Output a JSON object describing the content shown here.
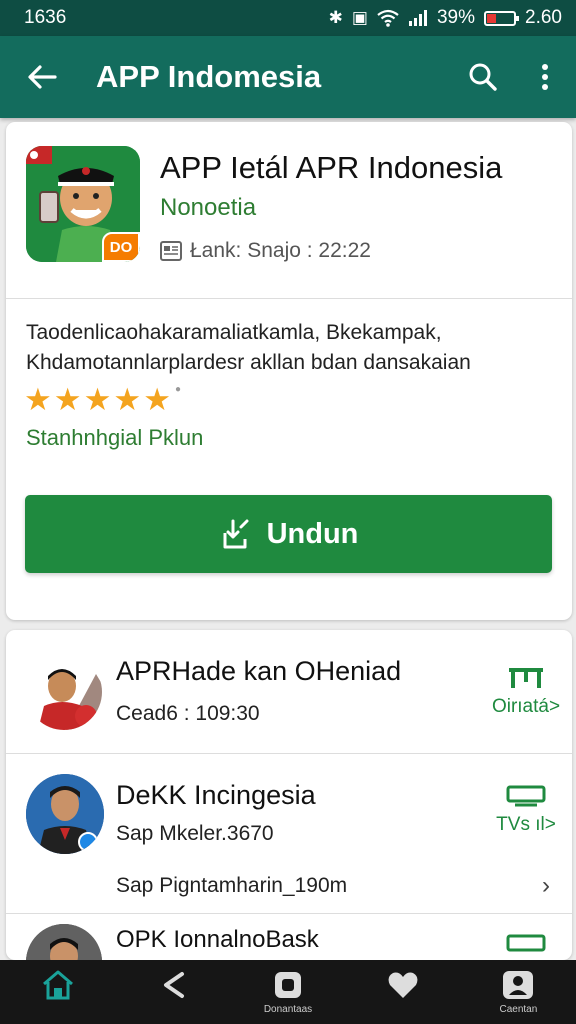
{
  "status_bar": {
    "time": "1636",
    "battery_text": "39%",
    "clock_right": "2.60"
  },
  "app_bar": {
    "title": "APP Indomesia"
  },
  "app": {
    "title": "APP Ietál APR Indonesia",
    "developer": "Nonoetia",
    "meta": "Łank: Snajo : 22:22",
    "badge": "DO",
    "description": "Taodenlicaohakaramaliatkamla, Bkekampak, Khdamotannlarplardesr akllan bdan dansakaian",
    "rating": 5,
    "rating_label": "Stanhnhgial Pklun",
    "download_label": "Undun"
  },
  "list": [
    {
      "title": "APRHade kan OHeniad",
      "subtitle": "Cead6 : 109:30",
      "action_label": "Oirıatá>"
    },
    {
      "title": "DeKK Incingesia",
      "subtitle": "Sap Mkeler.3670",
      "extra": "Sap Pigntamharin_190m",
      "action_label": "TVs ıl>"
    },
    {
      "title": "OPK IonnalnoBask",
      "subtitle": "",
      "action_label": ""
    }
  ],
  "bottom_nav": [
    {
      "icon": "home-icon",
      "label": "",
      "active": true
    },
    {
      "icon": "share-icon",
      "label": ""
    },
    {
      "icon": "downloads-icon",
      "label": "Donantaas"
    },
    {
      "icon": "heart-icon",
      "label": ""
    },
    {
      "icon": "profile-icon",
      "label": "Caentan"
    }
  ],
  "colors": {
    "primary": "#136c5d",
    "status": "#0e4d43",
    "accent": "#1f8a3f",
    "star": "#f4a41f"
  }
}
